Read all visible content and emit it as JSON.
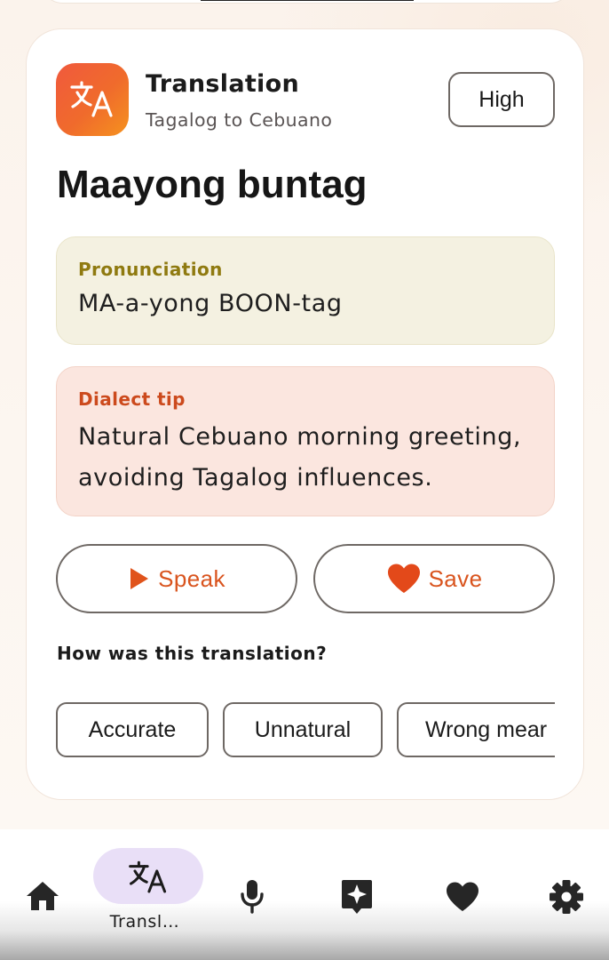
{
  "card": {
    "title": "Translation",
    "subtitle": "Tagalog to Cebuano",
    "quality_label": "High",
    "phrase": "Maayong buntag",
    "pronunciation": {
      "label": "Pronunciation",
      "text": "MA-a-yong BOON-tag"
    },
    "dialect_tip": {
      "label": "Dialect tip",
      "line1": "Natural Cebuano morning greeting,",
      "line2": "avoiding Tagalog influences."
    },
    "actions": {
      "speak_label": "Speak",
      "save_label": "Save"
    },
    "feedback": {
      "question": "How was this translation?",
      "options": [
        "Accurate",
        "Unnatural",
        "Wrong mear"
      ]
    }
  },
  "bottom_nav": {
    "items": [
      {
        "icon": "home-icon"
      },
      {
        "icon": "translate-icon",
        "label": "Transl…",
        "selected": true
      },
      {
        "icon": "microphone-icon"
      },
      {
        "icon": "sparkle-icon"
      },
      {
        "icon": "heart-icon"
      },
      {
        "icon": "gear-icon"
      }
    ]
  },
  "colors": {
    "accent": "#d9541e",
    "pronunciation_bg": "#f4f1e1",
    "tip_bg": "#fbe6df",
    "nav_selected_bg": "#e9dff7"
  }
}
